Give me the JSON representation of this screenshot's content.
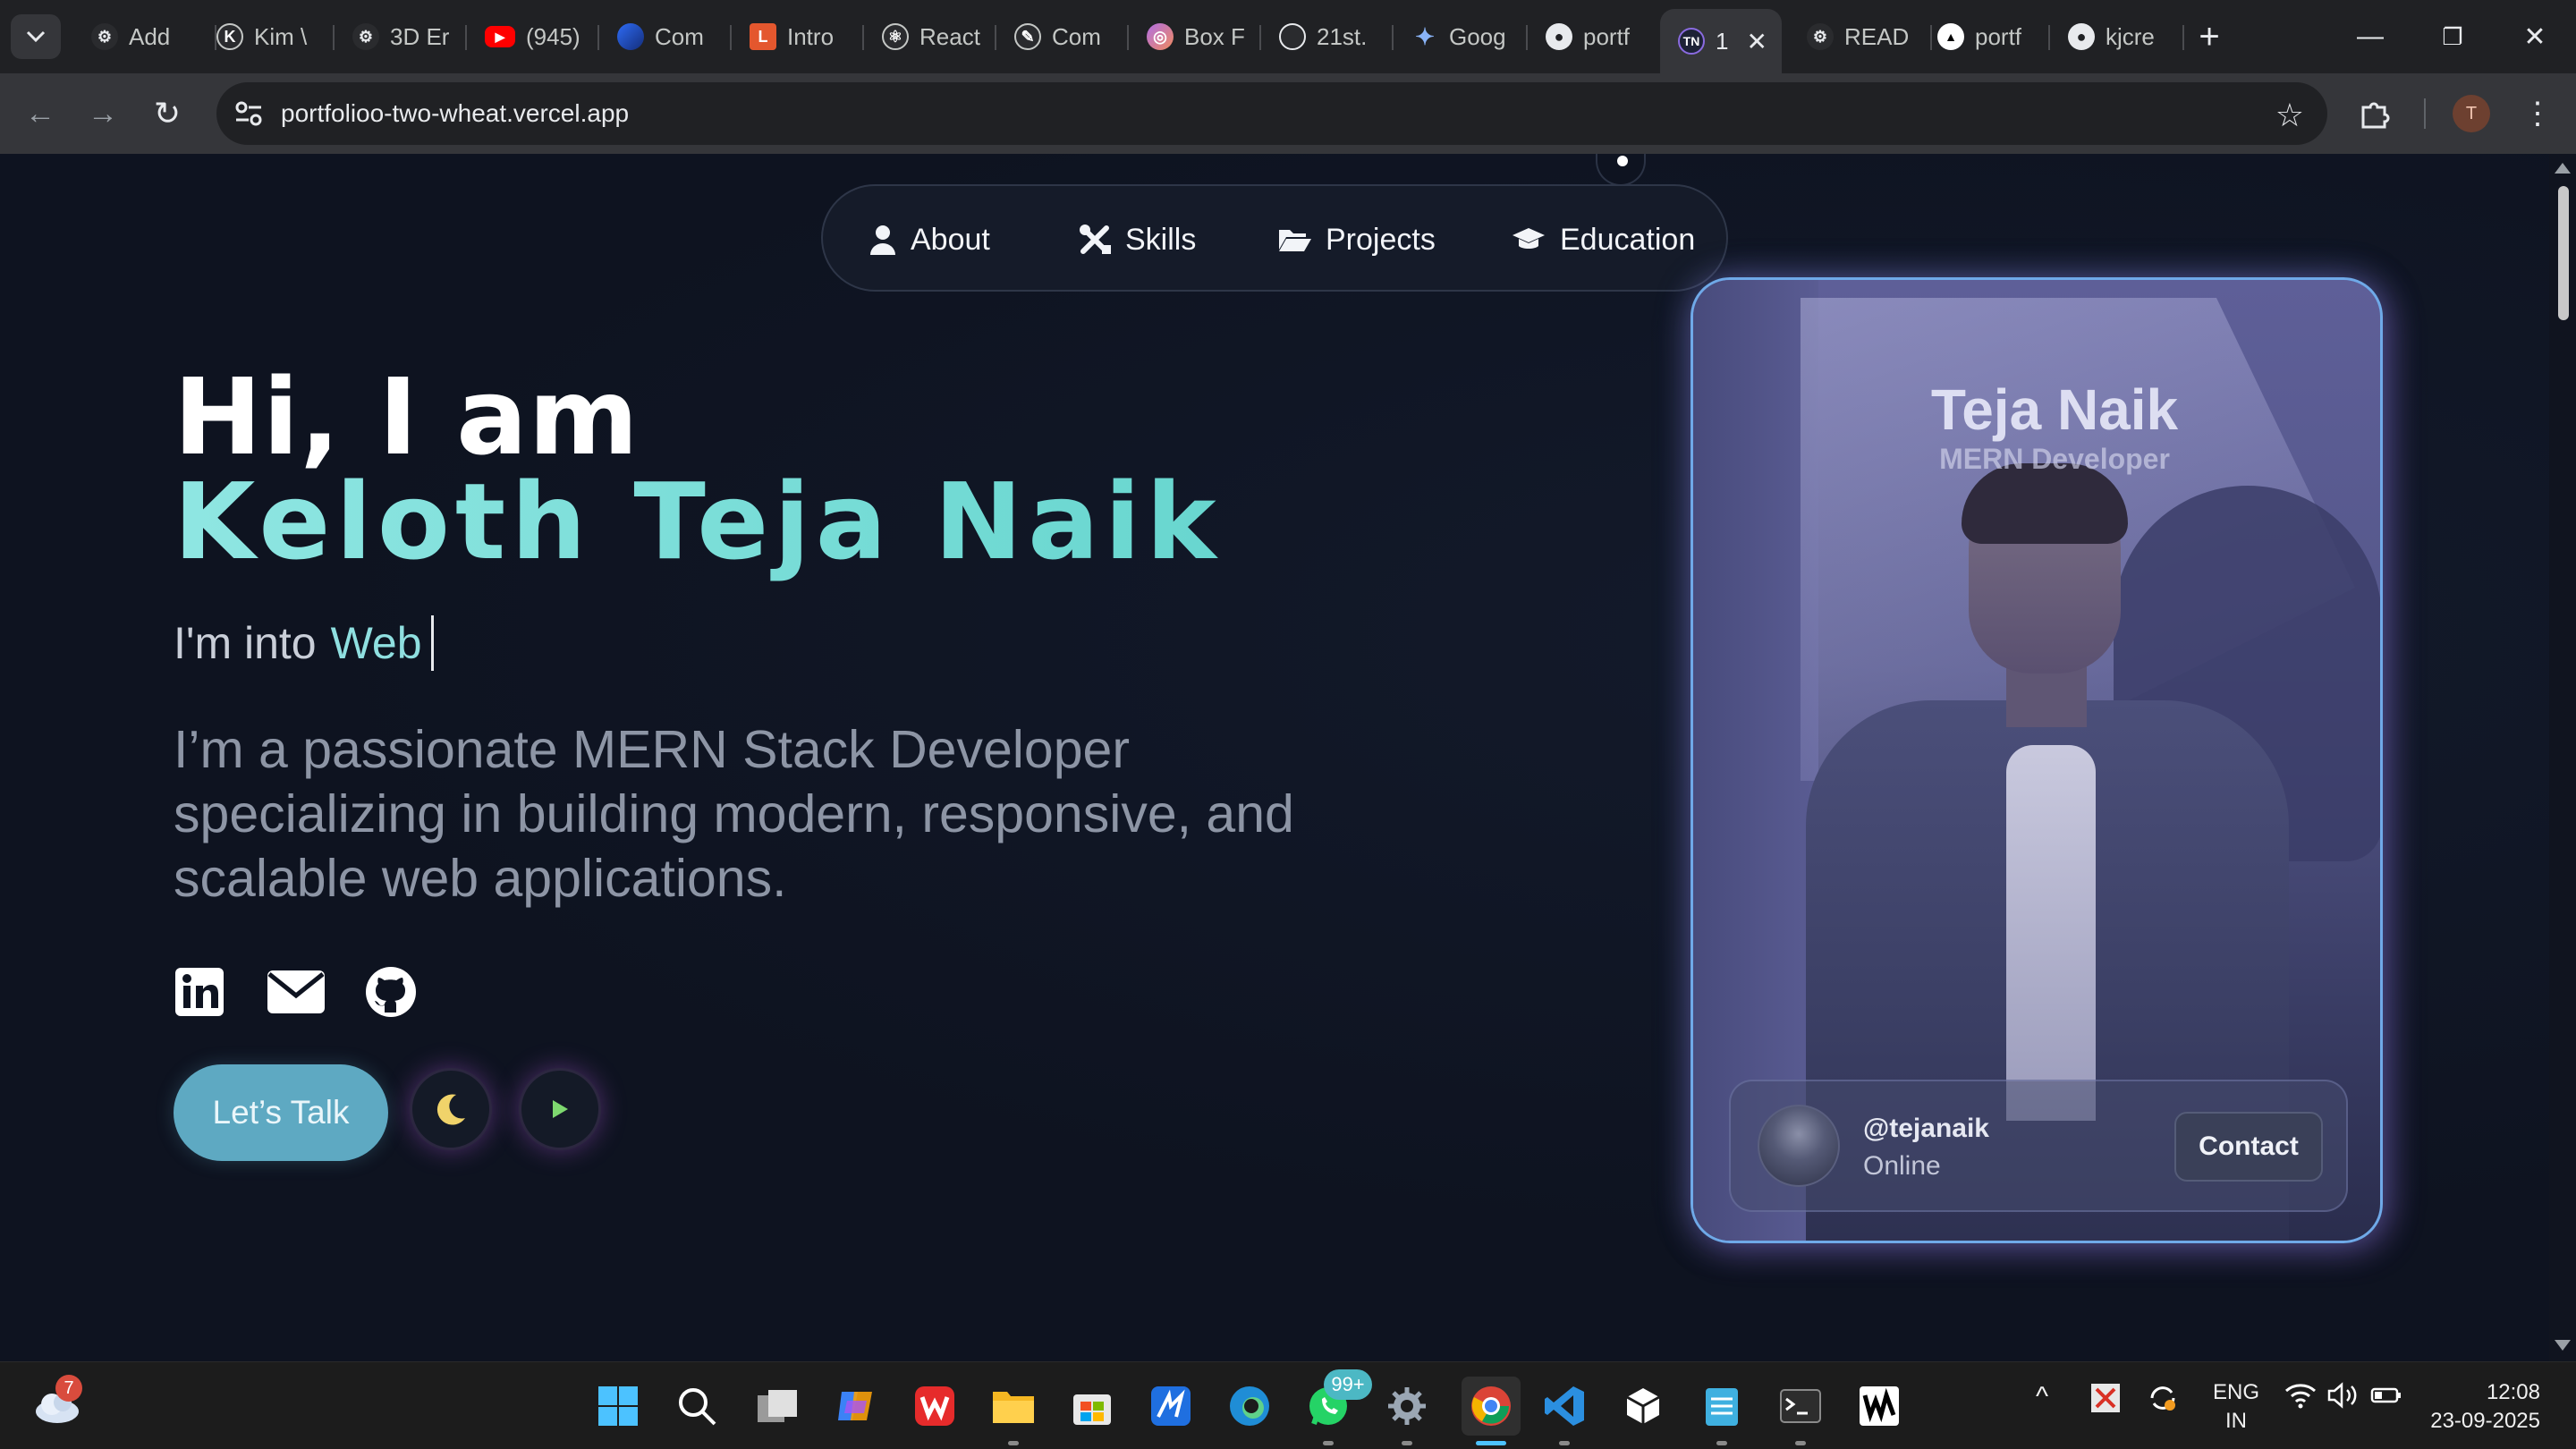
{
  "browser": {
    "tabs": [
      {
        "label": "Add",
        "icon": "chatgpt-icon"
      },
      {
        "label": "Kim \\",
        "icon": "globe-icon"
      },
      {
        "label": "3D Er",
        "icon": "chatgpt-icon"
      },
      {
        "label": "(945)",
        "icon": "youtube-icon"
      },
      {
        "label": "Com",
        "icon": "edge-icon"
      },
      {
        "label": "Intro",
        "icon": "l-logo-icon"
      },
      {
        "label": "React",
        "icon": "react-icon"
      },
      {
        "label": "Com",
        "icon": "pen-icon"
      },
      {
        "label": "Box F",
        "icon": "box-icon"
      },
      {
        "label": "21st.",
        "icon": "21st-icon"
      },
      {
        "label": "Goog",
        "icon": "gemini-icon"
      },
      {
        "label": "portf",
        "icon": "github-icon"
      },
      {
        "label": "1",
        "icon": "portfolio-icon",
        "active": true
      },
      {
        "label": "READ",
        "icon": "chatgpt-icon"
      },
      {
        "label": "portf",
        "icon": "vercel-icon"
      },
      {
        "label": "kjcre",
        "icon": "github-icon"
      }
    ],
    "url": "portfolioo-two-wheat.vercel.app",
    "profile_initial": "T"
  },
  "nav": {
    "items": [
      {
        "label": "About",
        "icon": "user-icon"
      },
      {
        "label": "Skills",
        "icon": "tools-icon"
      },
      {
        "label": "Projects",
        "icon": "folder-open-icon"
      },
      {
        "label": "Education",
        "icon": "graduation-cap-icon"
      }
    ]
  },
  "hero": {
    "greeting": "Hi, I am",
    "name": "Keloth Teja Naik",
    "typing_prefix": "I'm into",
    "typing_word": "Web",
    "bio": "I’m a passionate MERN Stack Developer specializing in building modern, responsive, and scalable web applications.",
    "social": [
      {
        "icon": "linkedin-icon"
      },
      {
        "icon": "email-icon"
      },
      {
        "icon": "github-icon"
      }
    ],
    "cta_label": "Let’s Talk",
    "theme_icon": "moon-icon",
    "play_icon": "play-icon"
  },
  "card": {
    "title": "Teja Naik",
    "subtitle": "MERN Developer",
    "handle": "@tejanaik",
    "status": "Online",
    "contact_label": "Contact"
  },
  "taskbar": {
    "weather_badge": "7",
    "whatsapp_badge": "99+",
    "lang_line1": "ENG",
    "lang_line2": "IN",
    "time": "12:08",
    "date": "23-09-2025"
  },
  "colors": {
    "accent": "#7fe3e0",
    "background": "#0e1320",
    "cta": "#5ea9c2",
    "card_border": "#6fa9e8"
  }
}
